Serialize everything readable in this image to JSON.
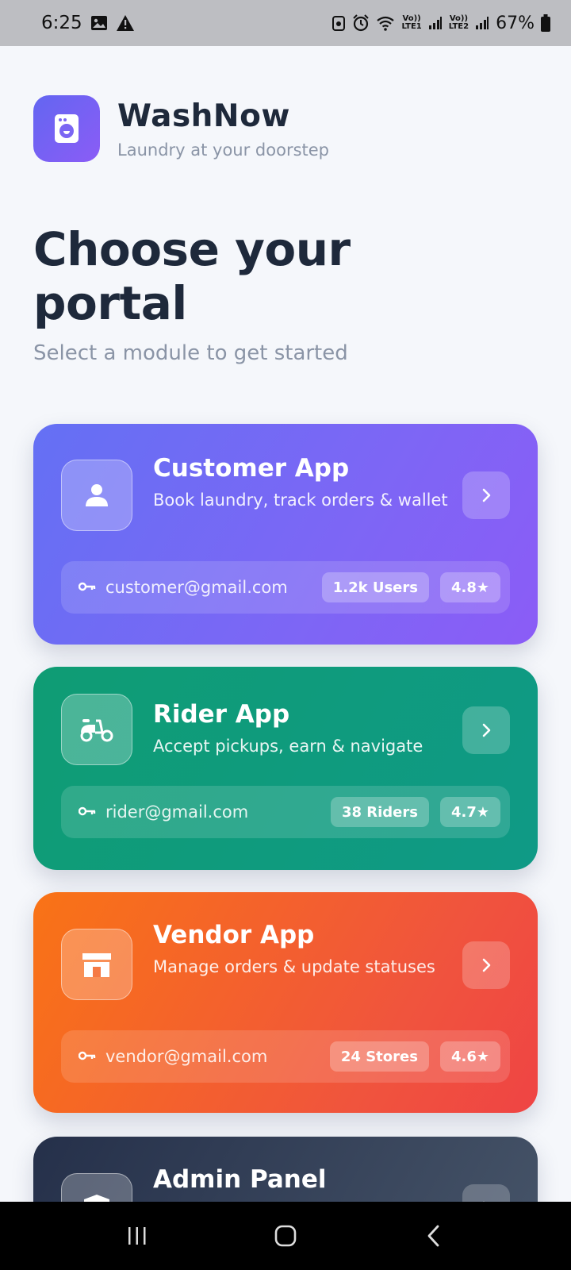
{
  "status_bar": {
    "time": "6:25",
    "battery": "67%",
    "sim1": "LTE1",
    "sim2": "LTE2",
    "volte": "Vo))",
    "icons": [
      "image-icon",
      "alert-icon",
      "sim-icon",
      "alarm-icon",
      "wifi-icon",
      "signal-icon",
      "battery-icon"
    ]
  },
  "brand": {
    "name": "WashNow",
    "tagline": "Laundry at your doorstep",
    "logo_icon": "washing-machine-icon"
  },
  "heading": {
    "title": "Choose your portal",
    "subtitle": "Select a module to get started"
  },
  "portals": [
    {
      "title": "Customer App",
      "description": "Book laundry, track orders & wallet",
      "email": "customer@gmail.com",
      "stat": "1.2k Users",
      "rating": "4.8★",
      "icon": "user-icon",
      "color": "#6470f4"
    },
    {
      "title": "Rider App",
      "description": "Accept pickups, earn & navigate",
      "email": "rider@gmail.com",
      "stat": "38 Riders",
      "rating": "4.7★",
      "icon": "scooter-icon",
      "color": "#0f9c74"
    },
    {
      "title": "Vendor App",
      "description": "Manage orders & update statuses",
      "email": "vendor@gmail.com",
      "stat": "24 Stores",
      "rating": "4.6★",
      "icon": "store-icon",
      "color": "#f97316"
    },
    {
      "title": "Admin Panel",
      "icon": "shield-icon",
      "color": "#25304a"
    }
  ]
}
